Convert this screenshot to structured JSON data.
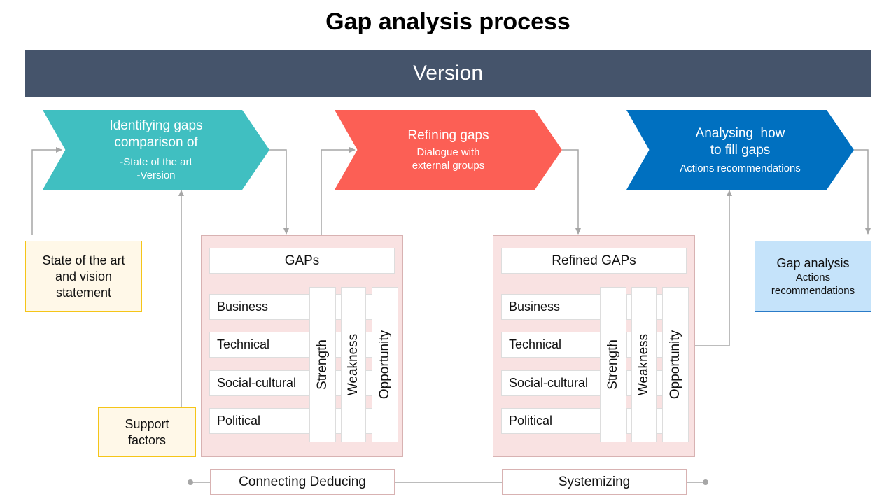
{
  "title": "Gap analysis process",
  "version_bar": "Version",
  "colors": {
    "version_bar": "#45546b",
    "identify": "#40bfc1",
    "refine": "#fc5f55",
    "analyse": "#0070c0",
    "panel_bg": "#f9e2e2",
    "note_yellow_bg": "#fff8e8",
    "note_yellow_border": "#f5c518",
    "note_blue_bg": "#c5e3fa",
    "note_blue_border": "#2a7bc8",
    "connector": "#a6a6a6"
  },
  "stages": [
    {
      "title": "Identifying gaps comparison of",
      "lines": [
        "-State of the art",
        "-Version"
      ]
    },
    {
      "title": "Refining gaps",
      "lines": [
        "Dialogue with",
        "external groups"
      ]
    },
    {
      "title_line1": "Analysing  how",
      "title_line2": "to fill gaps",
      "lines": [
        "Actions recommendations"
      ]
    }
  ],
  "notes": {
    "state": "State of the art and vision statement",
    "support": "Support factors",
    "gap_analysis_title": "Gap analysis",
    "gap_analysis_sub": "Actions recommendations"
  },
  "panels": [
    {
      "header": "GAPs",
      "rows": [
        "Business",
        "Technical",
        "Social-cultural",
        "Political"
      ],
      "columns": [
        "Strength",
        "Weakness",
        "Opportunity"
      ]
    },
    {
      "header": "Refined GAPs",
      "rows": [
        "Business",
        "Technical",
        "Social-cultural",
        "Political"
      ],
      "columns": [
        "Strength",
        "Weakness",
        "Opportunity"
      ]
    }
  ],
  "steps": [
    "Connecting Deducing",
    "Systemizing"
  ]
}
